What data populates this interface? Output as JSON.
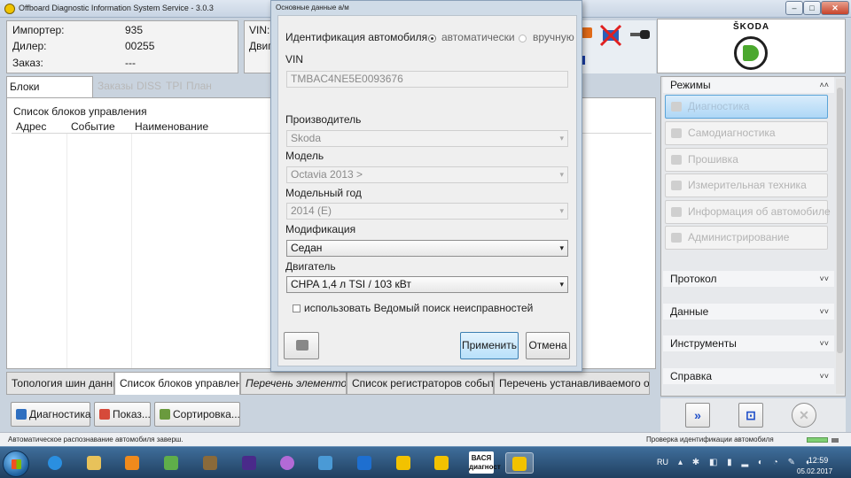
{
  "window": {
    "title": "Offboard Diagnostic Information System Service - 3.0.3",
    "minimize_glyph": "–",
    "maximize_glyph": "□",
    "close_glyph": "✕"
  },
  "info": {
    "importer_label": "Импортер:",
    "importer_value": "935",
    "dealer_label": "Дилер:",
    "dealer_value": "00255",
    "order_label": "Заказ:",
    "order_value": "---",
    "vin_label": "VIN:",
    "engine_label": "Двиг"
  },
  "logo": {
    "brand": "ŠKODA"
  },
  "tabs": {
    "blocks": "Блоки управления",
    "orders": "Заказы",
    "diss": "DISS",
    "tpi": "TPI",
    "plan": "План диагностики"
  },
  "list": {
    "title": "Список блоков управления",
    "columns": [
      "Адрес",
      "Событие",
      "Наименование"
    ]
  },
  "bottom_tabs": [
    "Топология шин данных",
    "Список блоков управления",
    "Перечень элементов",
    "Список регистраторов событий",
    "Перечень устанавливаемого о..."
  ],
  "actions": {
    "diagnostics": "Диагностика",
    "show": "Показ...",
    "sort": "Сортировка..."
  },
  "sidebar": {
    "modes_title": "Режимы",
    "modes": [
      "Диагностика",
      "Самодиагностика",
      "Прошивка",
      "Измерительная техника",
      "Информация об автомобиле",
      "Администрирование"
    ],
    "protocol": "Протокол",
    "data": "Данные",
    "tools": "Инструменты",
    "help": "Справка",
    "collapse_glyph": "˄˄",
    "expand_glyph": "˅˅",
    "nav_forward_glyph": "»",
    "nav_center_glyph": "⊡",
    "nav_stop_glyph": "✕"
  },
  "status": {
    "left": "Автоматическое распознавание автомобиля заверш.",
    "right": "Проверка идентификации автомобиля"
  },
  "dialog": {
    "title": "Основные данные а/м",
    "identification_label": "Идентификация автомобиля",
    "auto_label": "автоматически",
    "manual_label": "вручную",
    "vin_label": "VIN",
    "vin_value": "TMBAC4NE5E0093676",
    "maker_label": "Производитель",
    "maker_value": "Skoda",
    "model_label": "Модель",
    "model_value": "Octavia 2013 >",
    "year_label": "Модельный год",
    "year_value": "2014 (E)",
    "modification_label": "Модификация",
    "modification_value": "Седан",
    "engine_label": "Двигатель",
    "engine_value": "CHPA 1,4 л TSI / 103 кВт",
    "guided_search_label": "использовать Ведомый поиск неисправностей",
    "apply_button": "Применить",
    "cancel_button": "Отмена"
  },
  "taskbar": {
    "vasya_label": "ВАСЯ диагност",
    "lang": "RU",
    "time": "12:59",
    "date": "05.02.2017"
  },
  "colors": {
    "accent": "#3c7fb1",
    "skoda_green": "#4ba82e",
    "selected_mode": "#aed7f6"
  }
}
